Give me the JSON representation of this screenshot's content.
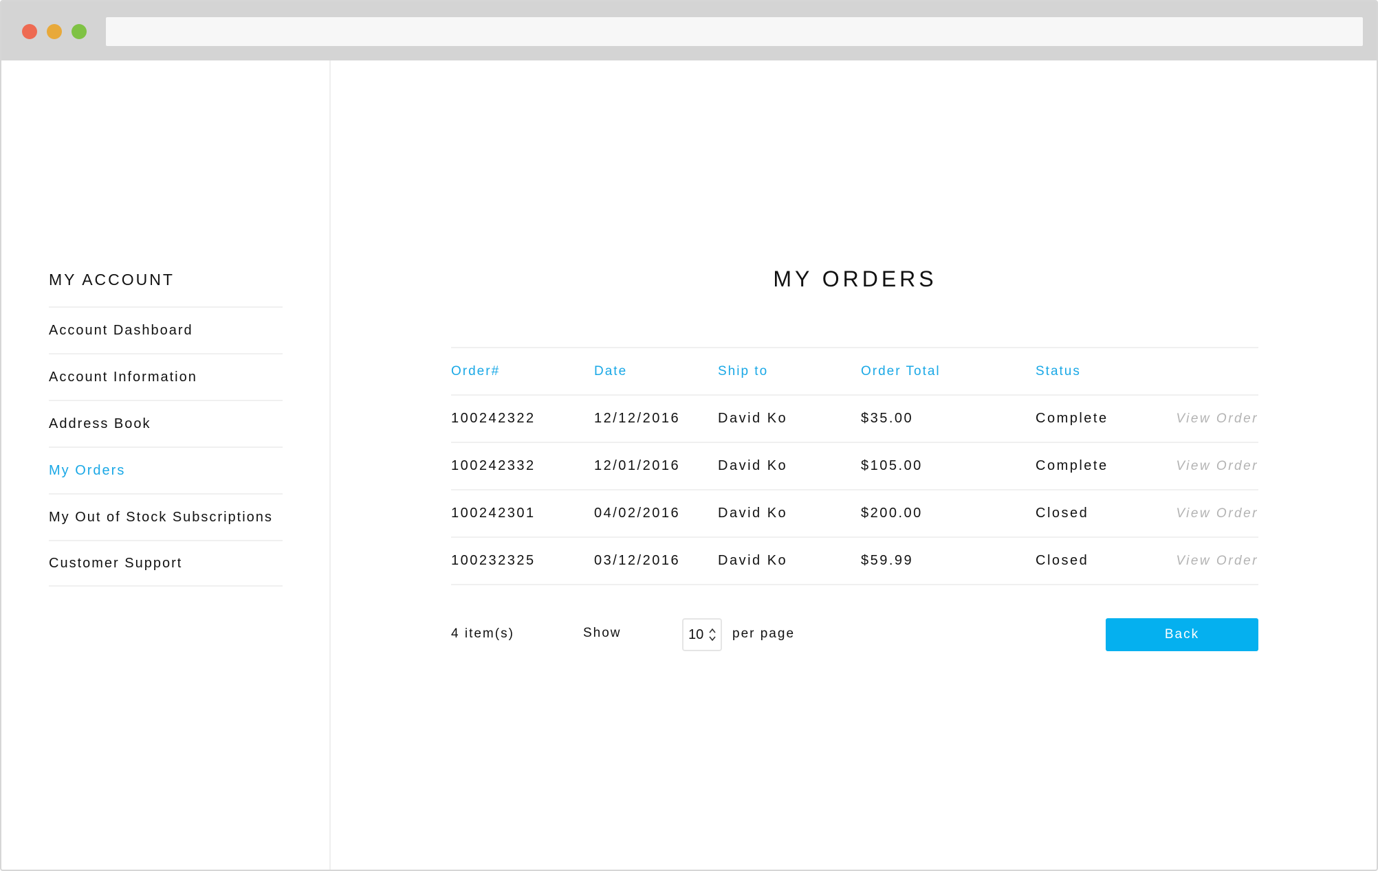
{
  "sidebar": {
    "title": "MY ACCOUNT",
    "items": [
      {
        "label": "Account Dashboard"
      },
      {
        "label": "Account Information"
      },
      {
        "label": "Address Book"
      },
      {
        "label": "My Orders",
        "active": true
      },
      {
        "label": "My Out of Stock Subscriptions"
      },
      {
        "label": "Customer Support"
      }
    ]
  },
  "main": {
    "title": "MY ORDERS",
    "table": {
      "columns": [
        "Order#",
        "Date",
        "Ship to",
        "Order Total",
        "Status"
      ],
      "rows": [
        {
          "order": "100242322",
          "date": "12/12/2016",
          "ship_to": "David Ko",
          "total": "$35.00",
          "status": "Complete",
          "action": "View Order"
        },
        {
          "order": "100242332",
          "date": "12/01/2016",
          "ship_to": "David Ko",
          "total": "$105.00",
          "status": "Complete",
          "action": "View Order"
        },
        {
          "order": "100242301",
          "date": "04/02/2016",
          "ship_to": "David Ko",
          "total": "$200.00",
          "status": "Closed",
          "action": "View Order"
        },
        {
          "order": "100232325",
          "date": "03/12/2016",
          "ship_to": "David Ko",
          "total": "$59.99",
          "status": "Closed",
          "action": "View Order"
        }
      ]
    },
    "footer": {
      "items_count": "4 item(s)",
      "show_label": "Show",
      "per_page_value": "10",
      "per_page_label": "per page",
      "back_label": "Back"
    }
  },
  "colors": {
    "accent": "#1aa8e6",
    "button": "#05b0ef",
    "muted": "#b3b3b3"
  }
}
